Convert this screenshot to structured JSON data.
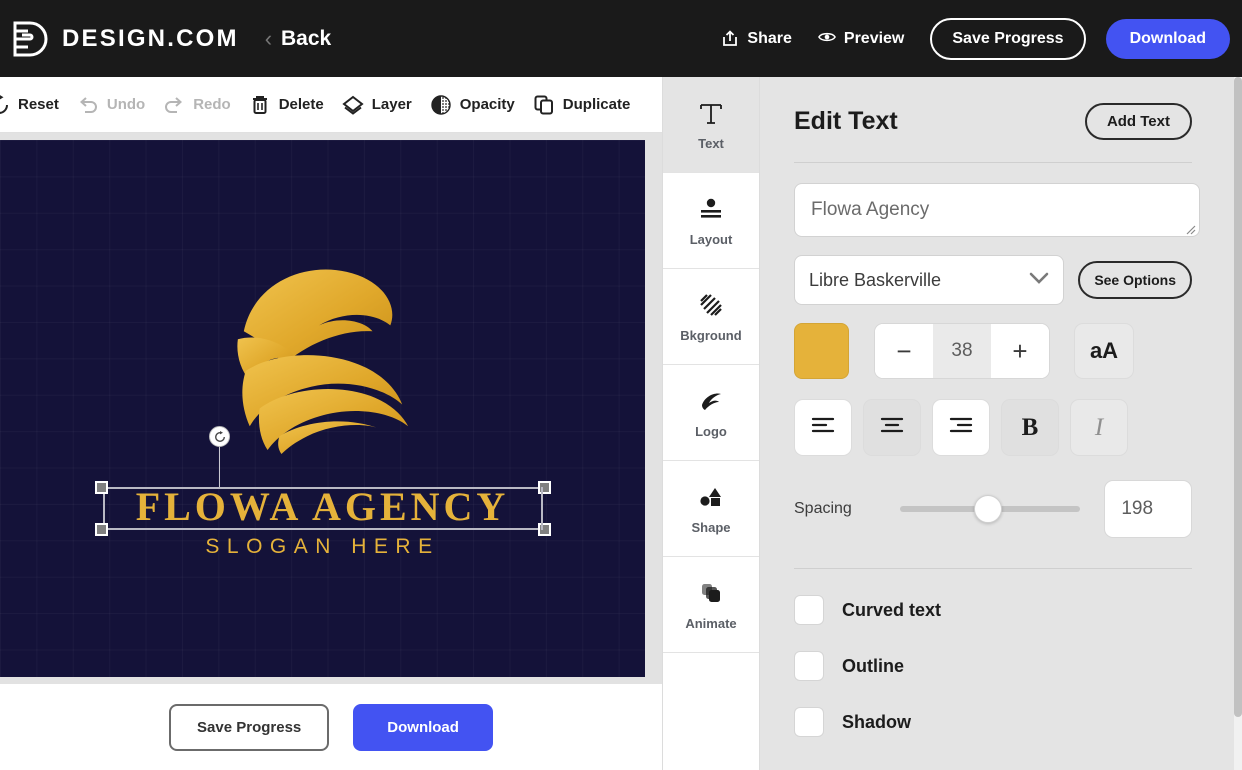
{
  "header": {
    "brand_name": "DESIGN.COM",
    "brand_logo_icon": "design-d-logo-icon",
    "back_chevron_icon": "chevron-left-icon",
    "back_label": "Back",
    "share_icon": "share-icon",
    "share_label": "Share",
    "preview_icon": "eye-icon",
    "preview_label": "Preview",
    "save_progress_label": "Save Progress",
    "download_label": "Download",
    "accent_color": "#4353f2",
    "background_color": "#1a1a1a"
  },
  "toolbar": {
    "items": [
      {
        "label": "Reset",
        "icon": "reset-circular-arrow-icon",
        "disabled": false
      },
      {
        "label": "Undo",
        "icon": "undo-arrow-icon",
        "disabled": true
      },
      {
        "label": "Redo",
        "icon": "redo-arrow-icon",
        "disabled": true
      },
      {
        "label": "Delete",
        "icon": "trash-icon",
        "disabled": false
      },
      {
        "label": "Layer",
        "icon": "layers-diamond-icon",
        "disabled": false
      },
      {
        "label": "Opacity",
        "icon": "opacity-circle-icon",
        "disabled": false
      },
      {
        "label": "Duplicate",
        "icon": "duplicate-copy-icon",
        "disabled": false
      }
    ]
  },
  "canvas": {
    "background_color": "#141239",
    "logo_color": "#e5b23a",
    "logo_mark_icon": "abstract-gold-bird-circle-icon",
    "title_text": "FLOWA AGENCY",
    "slogan_text": "SLOGAN HERE",
    "selection": {
      "rotate_icon": "rotate-handle-icon",
      "handle_icon": "resize-handle-icon"
    },
    "footer": {
      "save_progress_label": "Save Progress",
      "download_label": "Download"
    }
  },
  "rail": {
    "items": [
      {
        "label": "Text",
        "icon": "text-t-icon",
        "active": true
      },
      {
        "label": "Layout",
        "icon": "layout-icon",
        "active": false
      },
      {
        "label": "Bkground",
        "icon": "background-hatch-icon",
        "active": false
      },
      {
        "label": "Logo",
        "icon": "logo-swoosh-icon",
        "active": false
      },
      {
        "label": "Shape",
        "icon": "shapes-icon",
        "active": false
      },
      {
        "label": "Animate",
        "icon": "animate-layers-icon",
        "active": false
      }
    ]
  },
  "panel": {
    "title": "Edit Text",
    "add_text_label": "Add Text",
    "text_value": "Flowa Agency",
    "text_placeholder": "Flowa Agency",
    "resize_grip_icon": "resize-grip-icon",
    "font_name": "Libre Baskerville",
    "font_dropdown_icon": "chevron-down-icon",
    "see_options_label": "See Options",
    "color_swatch": "#e5b23a",
    "color_swatch_icon": "color-swatch-icon",
    "font_size": "38",
    "decrease_label": "−",
    "increase_label": "+",
    "case_label": "aA",
    "align_left_icon": "align-left-icon",
    "align_center_icon": "align-center-icon",
    "align_right_icon": "align-right-icon",
    "bold_label": "B",
    "italic_label": "I",
    "spacing_label": "Spacing",
    "spacing_value": "198",
    "checkboxes": [
      {
        "label": "Curved text",
        "checked": false
      },
      {
        "label": "Outline",
        "checked": false
      },
      {
        "label": "Shadow",
        "checked": false
      }
    ]
  }
}
